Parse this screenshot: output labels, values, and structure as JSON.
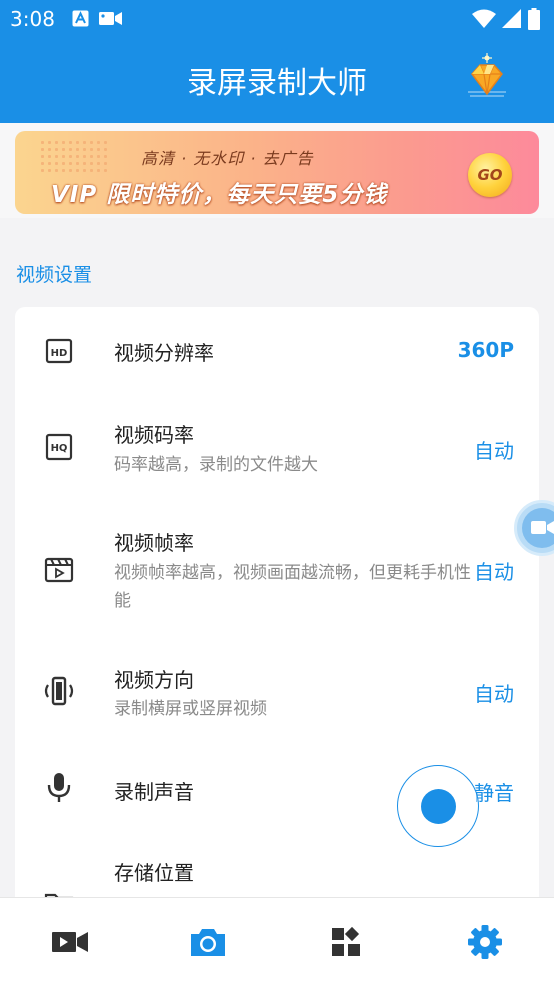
{
  "status_bar": {
    "time": "3:08",
    "left_icons": [
      "a-badge-icon",
      "video-camera-icon"
    ],
    "right_icons": [
      "wifi-icon",
      "cell-signal-icon",
      "battery-icon"
    ]
  },
  "app_bar": {
    "title": "录屏录制大师",
    "vip_icon": "vip-diamond-icon"
  },
  "banner": {
    "subtitle": "高清 · 无水印 · 去广告",
    "main_text": "VIP 限时特价，每天只要5分钱",
    "go_label": "GO"
  },
  "section": {
    "title": "视频设置"
  },
  "settings": [
    {
      "icon": "hd-icon",
      "title": "视频分辨率",
      "desc": "",
      "value": "360P"
    },
    {
      "icon": "hq-icon",
      "title": "视频码率",
      "desc": "码率越高，录制的文件越大",
      "value": "自动"
    },
    {
      "icon": "clapperboard-icon",
      "title": "视频帧率",
      "desc": "视频帧率越高，视频画面越流畅，但更耗手机性能",
      "value": "自动"
    },
    {
      "icon": "phone-rotate-icon",
      "title": "视频方向",
      "desc": "录制横屏或竖屏视频",
      "value": "自动"
    },
    {
      "icon": "microphone-icon",
      "title": "录制声音",
      "desc": "",
      "value": "静音"
    },
    {
      "icon": "folder-icon",
      "title": "存储位置",
      "desc": "",
      "value": ""
    }
  ],
  "bottom_nav": [
    {
      "icon": "video-camera-icon",
      "active": false
    },
    {
      "icon": "camera-icon",
      "active": false
    },
    {
      "icon": "apps-grid-icon",
      "active": false
    },
    {
      "icon": "settings-gear-icon",
      "active": true
    }
  ],
  "colors": {
    "primary": "#1a8fe6",
    "inactive_nav": "#333333",
    "text_primary": "#222222",
    "text_secondary": "#8a8a8a"
  }
}
